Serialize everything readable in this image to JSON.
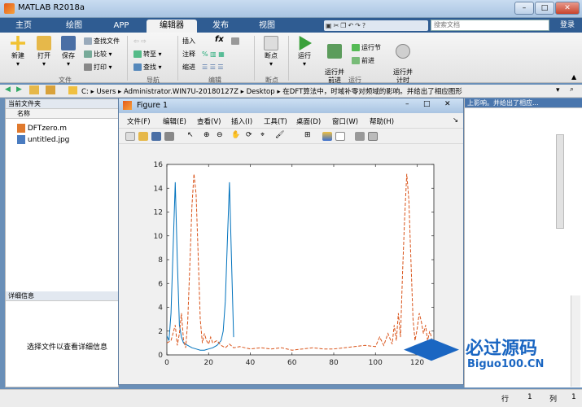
{
  "window": {
    "title": "MATLAB R2018a"
  },
  "ribbon_tabs": [
    "主页",
    "绘图",
    "APP",
    "编辑器",
    "发布",
    "视图"
  ],
  "active_tab": "编辑器",
  "search": {
    "placeholder": "搜索文档"
  },
  "login_label": "登录",
  "ribbon": {
    "file": {
      "new": "新建",
      "open": "打开",
      "save": "保存",
      "find_files": "查找文件",
      "compare": "比较",
      "print": "打印",
      "group": "文件"
    },
    "nav": {
      "goto": "转至",
      "find": "查找",
      "group": "导航"
    },
    "edit": {
      "insert": "插入",
      "comment": "注释",
      "indent": "缩进",
      "fx": "fx",
      "group": "编辑"
    },
    "breakpoints": {
      "label": "断点",
      "group": "断点"
    },
    "run": {
      "run": "运行",
      "run_advance": "运行并\n前进",
      "run_section": "运行节",
      "advance": "前进",
      "run_time": "运行并\n计时",
      "group": "运行"
    }
  },
  "address": {
    "segments": [
      "C:",
      "Users",
      "Administrator.WIN7U-20180127Z",
      "Desktop",
      "在DFT算法中，时域补零对频域的影响。并给出了相应图形"
    ]
  },
  "left_panel": {
    "title": "当前文件夹",
    "column": "名称",
    "files": [
      "DFTzero.m",
      "untitled.jpg"
    ],
    "details_title": "详细信息",
    "details_text": "选择文件以查看详细信息"
  },
  "right_panel": {
    "header_text": "上影响。并给出了相应..."
  },
  "figure": {
    "title": "Figure 1",
    "menu": [
      "文件(F)",
      "编辑(E)",
      "查看(V)",
      "插入(I)",
      "工具(T)",
      "桌面(D)",
      "窗口(W)",
      "帮助(H)"
    ]
  },
  "status": {
    "row_label": "行",
    "row_value": "1",
    "col_label": "列",
    "col_value": "1"
  },
  "watermark": {
    "text1": "必过源码",
    "text2": "Biguo100.CN"
  },
  "colors": {
    "ribbon_tab_bg": "#2f5c92",
    "series1": "#0072bd",
    "series2": "#d95319"
  },
  "chart_data": {
    "type": "line",
    "xlim": [
      0,
      128
    ],
    "ylim": [
      0,
      16
    ],
    "xticks": [
      0,
      20,
      40,
      60,
      80,
      100,
      120
    ],
    "yticks": [
      0,
      2,
      4,
      6,
      8,
      10,
      12,
      14,
      16
    ],
    "series": [
      {
        "style": "solid",
        "x": [
          0,
          1,
          2,
          3,
          4,
          5,
          6,
          7,
          8,
          10,
          12,
          14,
          16,
          18,
          20,
          22,
          24,
          26,
          27,
          28,
          29,
          30,
          31,
          32
        ],
        "y": [
          1.6,
          1.2,
          3.5,
          9.0,
          14.5,
          8.0,
          2.5,
          1.5,
          1.0,
          0.8,
          0.6,
          0.5,
          0.4,
          0.4,
          0.5,
          0.6,
          0.8,
          1.2,
          2.0,
          4.5,
          9.5,
          14.5,
          8.0,
          1.5
        ]
      },
      {
        "style": "dashed",
        "x": [
          0,
          2,
          4,
          5,
          6,
          7,
          8,
          9,
          10,
          11,
          12,
          13,
          14,
          15,
          16,
          17,
          18,
          19,
          20,
          21,
          22,
          24,
          26,
          28,
          30,
          32,
          35,
          40,
          45,
          50,
          55,
          60,
          65,
          70,
          75,
          80,
          85,
          90,
          95,
          100,
          102,
          104,
          106,
          108,
          109,
          110,
          111,
          112,
          113,
          114,
          115,
          116,
          117,
          118,
          119,
          120,
          121,
          122,
          123,
          124,
          125,
          126,
          127
        ],
        "y": [
          1.0,
          1.2,
          2.5,
          0.8,
          1.8,
          3.5,
          1.2,
          0.6,
          2.8,
          7.5,
          12.5,
          15.2,
          13.5,
          8.5,
          3.0,
          1.0,
          1.8,
          1.2,
          0.9,
          1.5,
          1.0,
          1.2,
          0.8,
          0.6,
          0.9,
          0.6,
          0.7,
          0.5,
          0.6,
          0.5,
          0.6,
          0.4,
          0.5,
          0.6,
          0.5,
          0.5,
          0.6,
          0.7,
          0.8,
          0.7,
          1.5,
          0.8,
          1.8,
          0.9,
          2.5,
          1.2,
          3.5,
          1.5,
          7.0,
          11.5,
          15.2,
          13.0,
          8.0,
          3.0,
          1.2,
          2.2,
          3.5,
          2.8,
          1.8,
          2.5,
          1.2,
          2.0,
          1.4
        ]
      }
    ]
  }
}
